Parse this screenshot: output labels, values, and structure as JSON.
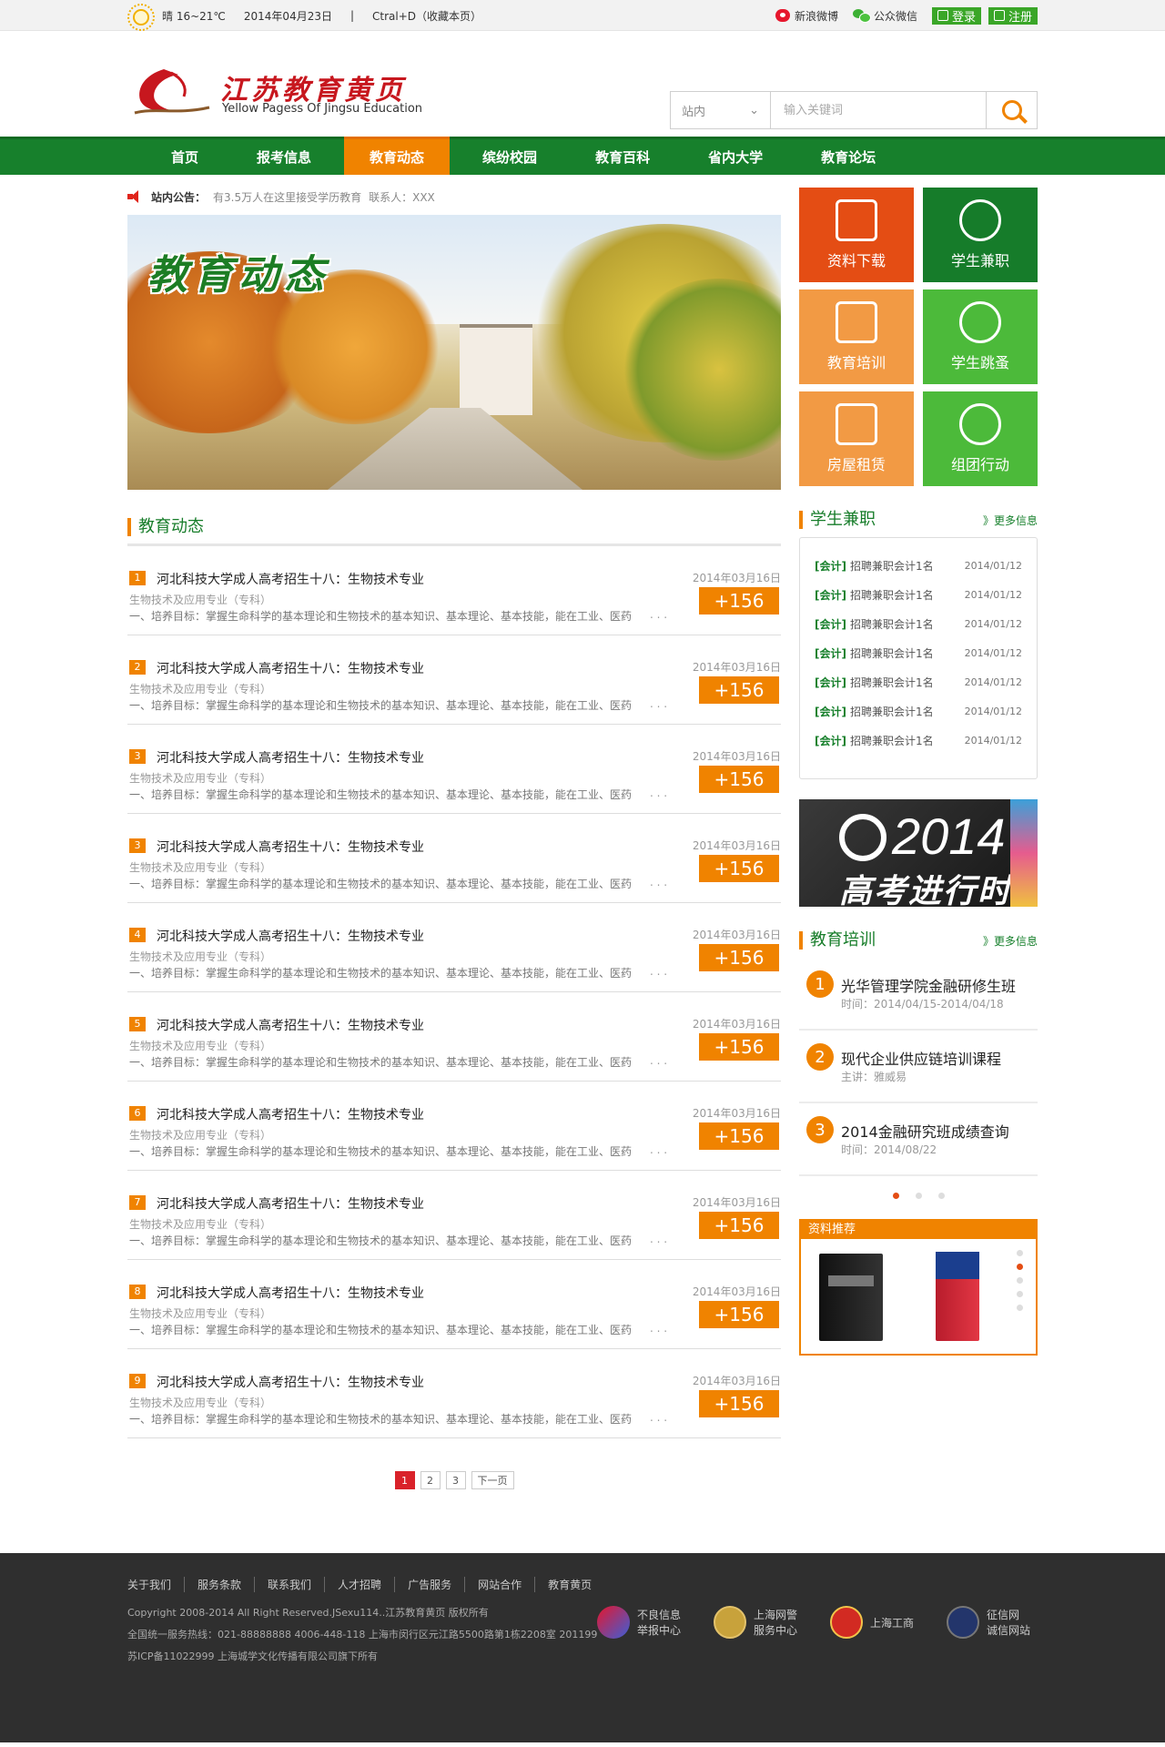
{
  "topbar": {
    "weather": "晴 16~21℃",
    "date": "2014年04月23日",
    "separator": "|",
    "bookmark": "Ctral+D（收藏本页）",
    "weibo": "新浪微博",
    "wechat": "公众微信",
    "login": "登录",
    "register": "注册"
  },
  "header": {
    "logo_cn": "江苏教育黄页",
    "logo_en": "Yellow Pagess Of Jingsu Education",
    "search_scope": "站内",
    "search_placeholder": "输入关键词"
  },
  "nav": {
    "items": [
      "首页",
      "报考信息",
      "教育动态",
      "缤纷校园",
      "教育百科",
      "省内大学",
      "教育论坛"
    ],
    "active": "教育动态"
  },
  "notice": {
    "label": "站内公告：",
    "text": "有3.5万人在这里接受学历教育",
    "contact": "联系人：XXX"
  },
  "banner": {
    "title": "教育动态"
  },
  "tiles": [
    "资料下载",
    "学生兼职",
    "教育培训",
    "学生跳蚤",
    "房屋租赁",
    "组团行动"
  ],
  "news_section": {
    "title": "教育动态",
    "items": [
      {
        "num": "1",
        "title": "河北科技大学成人高考招生十八：生物技术专业",
        "date": "2014年03月16日",
        "sub": "生物技术及应用专业（专科）",
        "desc": "一、培养目标：掌握生命科学的基本理论和生物技术的基本知识、基本理论、基本技能，能在工业、医药",
        "dots": ". . .",
        "plus": "+156"
      },
      {
        "num": "2",
        "title": "河北科技大学成人高考招生十八：生物技术专业",
        "date": "2014年03月16日",
        "sub": "生物技术及应用专业（专科）",
        "desc": "一、培养目标：掌握生命科学的基本理论和生物技术的基本知识、基本理论、基本技能，能在工业、医药",
        "dots": ". . .",
        "plus": "+156"
      },
      {
        "num": "3",
        "title": "河北科技大学成人高考招生十八：生物技术专业",
        "date": "2014年03月16日",
        "sub": "生物技术及应用专业（专科）",
        "desc": "一、培养目标：掌握生命科学的基本理论和生物技术的基本知识、基本理论、基本技能，能在工业、医药",
        "dots": ". . .",
        "plus": "+156"
      },
      {
        "num": "3",
        "title": "河北科技大学成人高考招生十八：生物技术专业",
        "date": "2014年03月16日",
        "sub": "生物技术及应用专业（专科）",
        "desc": "一、培养目标：掌握生命科学的基本理论和生物技术的基本知识、基本理论、基本技能，能在工业、医药",
        "dots": ". . .",
        "plus": "+156"
      },
      {
        "num": "4",
        "title": "河北科技大学成人高考招生十八：生物技术专业",
        "date": "2014年03月16日",
        "sub": "生物技术及应用专业（专科）",
        "desc": "一、培养目标：掌握生命科学的基本理论和生物技术的基本知识、基本理论、基本技能，能在工业、医药",
        "dots": ". . .",
        "plus": "+156"
      },
      {
        "num": "5",
        "title": "河北科技大学成人高考招生十八：生物技术专业",
        "date": "2014年03月16日",
        "sub": "生物技术及应用专业（专科）",
        "desc": "一、培养目标：掌握生命科学的基本理论和生物技术的基本知识、基本理论、基本技能，能在工业、医药",
        "dots": ". . .",
        "plus": "+156"
      },
      {
        "num": "6",
        "title": "河北科技大学成人高考招生十八：生物技术专业",
        "date": "2014年03月16日",
        "sub": "生物技术及应用专业（专科）",
        "desc": "一、培养目标：掌握生命科学的基本理论和生物技术的基本知识、基本理论、基本技能，能在工业、医药",
        "dots": ". . .",
        "plus": "+156"
      },
      {
        "num": "7",
        "title": "河北科技大学成人高考招生十八：生物技术专业",
        "date": "2014年03月16日",
        "sub": "生物技术及应用专业（专科）",
        "desc": "一、培养目标：掌握生命科学的基本理论和生物技术的基本知识、基本理论、基本技能，能在工业、医药",
        "dots": ". . .",
        "plus": "+156"
      },
      {
        "num": "8",
        "title": "河北科技大学成人高考招生十八：生物技术专业",
        "date": "2014年03月16日",
        "sub": "生物技术及应用专业（专科）",
        "desc": "一、培养目标：掌握生命科学的基本理论和生物技术的基本知识、基本理论、基本技能，能在工业、医药",
        "dots": ". . .",
        "plus": "+156"
      },
      {
        "num": "9",
        "title": "河北科技大学成人高考招生十八：生物技术专业",
        "date": "2014年03月16日",
        "sub": "生物技术及应用专业（专科）",
        "desc": "一、培养目标：掌握生命科学的基本理论和生物技术的基本知识、基本理论、基本技能，能在工业、医药",
        "dots": ". . .",
        "plus": "+156"
      }
    ]
  },
  "pager": {
    "pages": [
      "1",
      "2",
      "3"
    ],
    "current": "1",
    "next": "下一页"
  },
  "jobs": {
    "title": "学生兼职",
    "more": "》更多信息",
    "items": [
      {
        "tag": "[会计]",
        "title": "招聘兼职会计1名",
        "date": "2014/01/12"
      },
      {
        "tag": "[会计]",
        "title": "招聘兼职会计1名",
        "date": "2014/01/12"
      },
      {
        "tag": "[会计]",
        "title": "招聘兼职会计1名",
        "date": "2014/01/12"
      },
      {
        "tag": "[会计]",
        "title": "招聘兼职会计1名",
        "date": "2014/01/12"
      },
      {
        "tag": "[会计]",
        "title": "招聘兼职会计1名",
        "date": "2014/01/12"
      },
      {
        "tag": "[会计]",
        "title": "招聘兼职会计1名",
        "date": "2014/01/12"
      },
      {
        "tag": "[会计]",
        "title": "招聘兼职会计1名",
        "date": "2014/01/12"
      }
    ]
  },
  "ad": {
    "year": "2014",
    "text": "高考进行时"
  },
  "training": {
    "title": "教育培训",
    "more": "》更多信息",
    "items": [
      {
        "num": "1",
        "title": "光华管理学院金融研修生班",
        "sub": "时间：2014/04/15-2014/04/18"
      },
      {
        "num": "2",
        "title": "现代企业供应链培训课程",
        "sub": "主讲：雅威易"
      },
      {
        "num": "3",
        "title": "2014金融研究班成绩查询",
        "sub": "时间：2014/08/22"
      }
    ]
  },
  "books": {
    "title": "资料推荐"
  },
  "footer": {
    "links": [
      "关于我们",
      "服务条款",
      "联系我们",
      "人才招聘",
      "广告服务",
      "网站合作",
      "教育黄页"
    ],
    "copyright": "Copyright 2008-2014 All Right Reserved.JSexu114..江苏教育黄页 版权所有",
    "hotline": "全国统一服务热线：021-88888888  4006-448-118   上海市闵行区元江路5500路第1栋2208室 201199",
    "icp": "苏ICP备11022999   上海城学文化传播有限公司旗下所有",
    "badges": [
      {
        "line1": "不良信息",
        "line2": "举报中心"
      },
      {
        "line1": "上海网警",
        "line2": "服务中心"
      },
      {
        "line1": "上海工商",
        "line2": ""
      },
      {
        "line1": "征信网",
        "line2": "诚信网站"
      }
    ]
  }
}
